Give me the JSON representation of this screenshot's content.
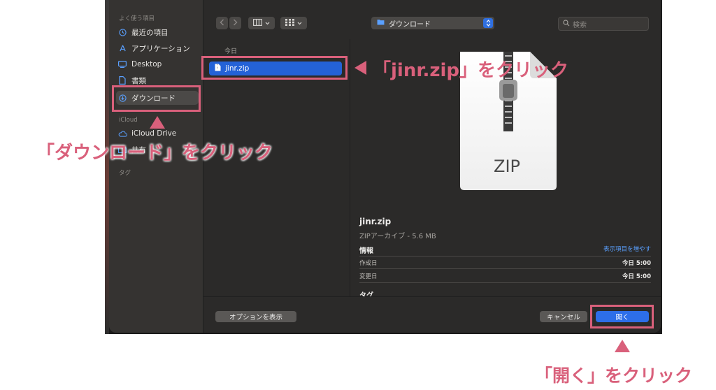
{
  "sidebar": {
    "favorites_label": "よく使う項目",
    "items": [
      {
        "label": "最近の項目",
        "icon": "clock-icon"
      },
      {
        "label": "アプリケーション",
        "icon": "apps-icon"
      },
      {
        "label": "Desktop",
        "icon": "desktop-icon"
      },
      {
        "label": "書類",
        "icon": "document-icon"
      },
      {
        "label": "ダウンロード",
        "icon": "download-icon",
        "selected": true
      }
    ],
    "icloud_label": "iCloud",
    "icloud_items": [
      {
        "label": "iCloud Drive",
        "icon": "cloud-icon"
      },
      {
        "label": "共有",
        "icon": "shared-folder-icon"
      }
    ],
    "tags_label": "タグ"
  },
  "toolbar": {
    "current_folder": "ダウンロード",
    "search_placeholder": "検索"
  },
  "file_column": {
    "header": "今日",
    "files": [
      {
        "name": "jinr.zip",
        "selected": true
      }
    ]
  },
  "preview": {
    "icon_label": "ZIP",
    "file_name": "jinr.zip",
    "kind_size": "ZIPアーカイブ - 5.6 MB",
    "info_label": "情報",
    "show_more": "表示項目を増やす",
    "created_label": "作成日",
    "created_value": "今日 5:00",
    "modified_label": "変更日",
    "modified_value": "今日 5:00",
    "tags_label": "タグ"
  },
  "footer": {
    "options_label": "オプションを表示",
    "cancel_label": "キャンセル",
    "open_label": "開く"
  },
  "annotations": {
    "download_note": "「ダウンロード」をクリック",
    "zip_note": "「jinr.zip」をクリック",
    "open_note": "「開く」をクリック"
  },
  "colors": {
    "annotation": "#d9607b",
    "accent": "#2462d7"
  }
}
